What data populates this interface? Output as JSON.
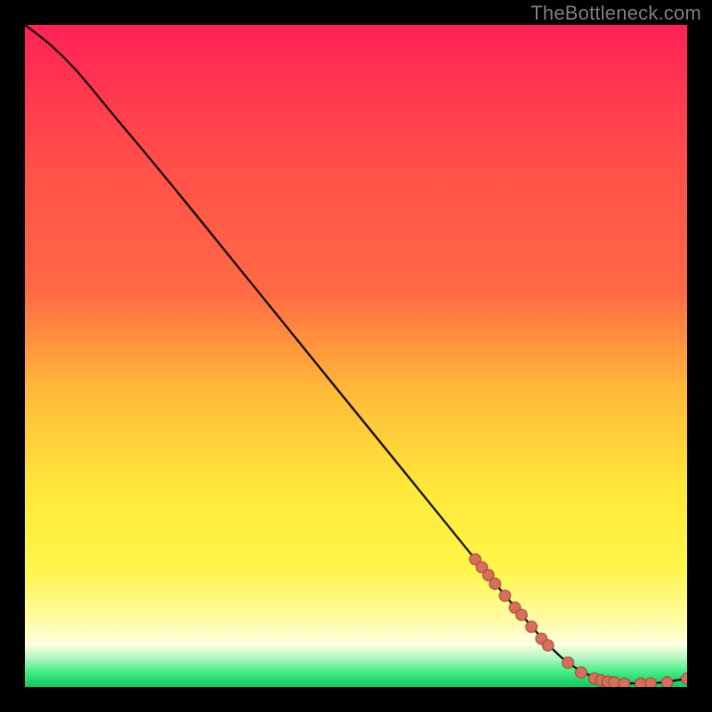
{
  "attribution": "TheBottleneck.com",
  "colors": {
    "frame": "#000000",
    "gradient_top": "#ff2257",
    "gradient_mid1": "#ff6a45",
    "gradient_mid2": "#ffb93a",
    "gradient_mid3": "#ffe83a",
    "gradient_mid4": "#fff64a",
    "gradient_mid5": "#fffca8",
    "gradient_bottom_band": "#4cf087",
    "gradient_bottom": "#14c462",
    "line": "#000000",
    "marker_fill": "#d66f5c",
    "marker_stroke": "#a4473a"
  },
  "plot": {
    "x_range": [
      0,
      100
    ],
    "y_range": [
      0,
      100
    ]
  },
  "chart_data": {
    "type": "line",
    "title": "",
    "xlabel": "",
    "ylabel": "",
    "xlim": [
      0,
      100
    ],
    "ylim": [
      0,
      100
    ],
    "series": [
      {
        "name": "curve",
        "x": [
          0,
          4,
          8,
          12,
          20,
          30,
          40,
          50,
          60,
          68,
          74,
          80,
          84,
          88,
          92,
          96,
          100
        ],
        "y": [
          100,
          97,
          93,
          88,
          78.5,
          66.2,
          53.8,
          41.5,
          29.2,
          19.3,
          12.0,
          5.2,
          2.2,
          0.8,
          0.5,
          0.6,
          1.3
        ]
      }
    ],
    "markers": [
      {
        "x": 68.0,
        "y": 19.3
      },
      {
        "x": 69.0,
        "y": 18.1
      },
      {
        "x": 70.0,
        "y": 16.9
      },
      {
        "x": 71.0,
        "y": 15.6
      },
      {
        "x": 72.5,
        "y": 13.8
      },
      {
        "x": 74.0,
        "y": 12.0
      },
      {
        "x": 75.0,
        "y": 10.9
      },
      {
        "x": 76.5,
        "y": 9.1
      },
      {
        "x": 78.0,
        "y": 7.3
      },
      {
        "x": 79.0,
        "y": 6.3
      },
      {
        "x": 82.0,
        "y": 3.7
      },
      {
        "x": 84.0,
        "y": 2.2
      },
      {
        "x": 86.0,
        "y": 1.3
      },
      {
        "x": 87.0,
        "y": 1.0
      },
      {
        "x": 88.0,
        "y": 0.8
      },
      {
        "x": 89.0,
        "y": 0.7
      },
      {
        "x": 90.5,
        "y": 0.5
      },
      {
        "x": 93.0,
        "y": 0.5
      },
      {
        "x": 94.5,
        "y": 0.55
      },
      {
        "x": 97.0,
        "y": 0.7
      },
      {
        "x": 100.0,
        "y": 1.3
      }
    ]
  }
}
